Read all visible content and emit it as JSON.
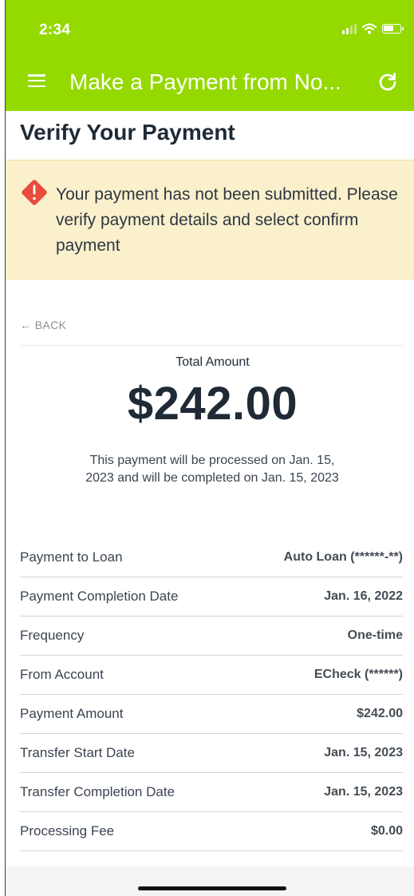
{
  "status_bar": {
    "time": "2:34"
  },
  "nav": {
    "title": "Make a Payment from No..."
  },
  "page": {
    "title": "Verify Your Payment"
  },
  "alert": {
    "message": "Your payment has not been submitted. Please verify payment details and select confirm payment"
  },
  "back": {
    "label": "← BACK"
  },
  "summary": {
    "total_label": "Total Amount",
    "total_amount": "$242.00",
    "note": "This payment will be processed on Jan. 15, 2023 and will be completed on Jan. 15, 2023"
  },
  "details": [
    {
      "label": "Payment to Loan",
      "value": "Auto Loan (******-**)"
    },
    {
      "label": "Payment Completion Date",
      "value": "Jan. 16, 2022"
    },
    {
      "label": "Frequency",
      "value": "One-time"
    },
    {
      "label": "From Account",
      "value": "ECheck (******)"
    },
    {
      "label": "Payment Amount",
      "value": "$242.00"
    },
    {
      "label": "Transfer Start Date",
      "value": "Jan. 15, 2023"
    },
    {
      "label": "Transfer Completion Date",
      "value": "Jan. 15, 2023"
    },
    {
      "label": "Processing Fee",
      "value": "$0.00"
    }
  ],
  "colors": {
    "header": "#94d900",
    "alert_bg": "#fbf0cc",
    "alert_icon": "#e74c3c"
  },
  "icons": [
    "menu-icon",
    "refresh-icon",
    "warning-icon",
    "signal-icon",
    "wifi-icon",
    "battery-icon"
  ]
}
